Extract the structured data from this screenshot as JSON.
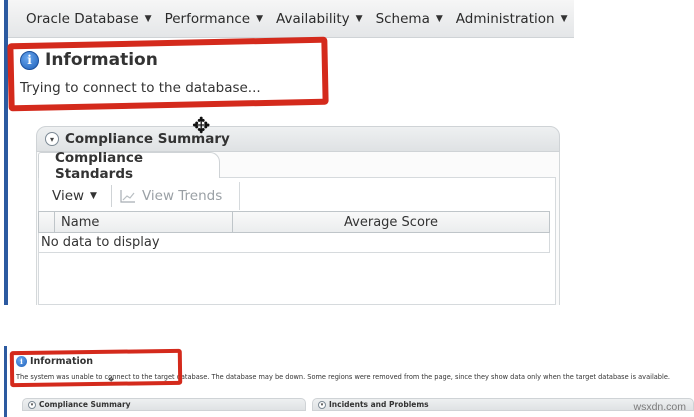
{
  "menu": {
    "items": [
      {
        "label": "Oracle Database",
        "id": "oracle-database"
      },
      {
        "label": "Performance",
        "id": "performance"
      },
      {
        "label": "Availability",
        "id": "availability"
      },
      {
        "label": "Schema",
        "id": "schema"
      },
      {
        "label": "Administration",
        "id": "administration"
      }
    ],
    "caret": "▼"
  },
  "info": {
    "icon_glyph": "i",
    "title": "Information",
    "message": "Trying to connect to the database..."
  },
  "compliance": {
    "section_title": "Compliance Summary",
    "chevron": "▾",
    "tab_label": "Compliance Standards",
    "toolbar": {
      "view_label": "View",
      "view_caret": "▼",
      "trends_label": "View Trends"
    },
    "table": {
      "columns": [
        "Name",
        "Average Score"
      ],
      "empty_message": "No data to display"
    }
  },
  "bottom": {
    "info_icon_glyph": "i",
    "info_title": "Information",
    "info_message": "The system was unable to connect to the target database. The database may be down. Some regions were removed from the page, since they show data only when the target database is available.",
    "sections": [
      "Compliance Summary",
      "Incidents and Problems"
    ],
    "chevron": "▾"
  },
  "cursors": {
    "move": "✥",
    "pointer": "⌖"
  },
  "watermark": "wsxdn.com",
  "colors": {
    "highlight_red": "#d42a1c",
    "info_blue": "#1e5fb8",
    "left_border_blue": "#2c5aa0"
  }
}
